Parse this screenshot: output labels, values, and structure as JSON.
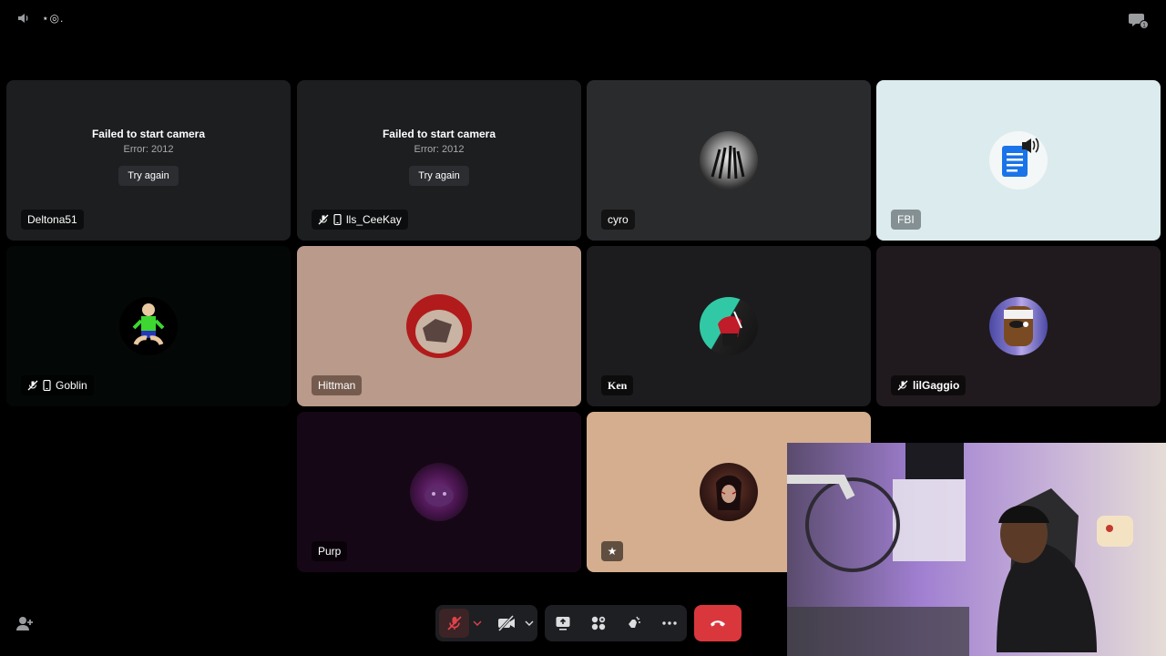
{
  "topbar": {
    "channel_status": "⋆◎."
  },
  "tiles": [
    {
      "name": "Deltona51",
      "camera_failed": true,
      "fail_title": "Failed to start camera",
      "fail_error": "Error: 2012",
      "retry_label": "Try again"
    },
    {
      "name": "lls_CeeKay",
      "camera_failed": true,
      "fail_title": "Failed to start camera",
      "fail_error": "Error: 2012",
      "retry_label": "Try again",
      "muted": true,
      "mobile": true
    },
    {
      "name": "cyro"
    },
    {
      "name": "FBI"
    },
    {
      "name": "Goblin",
      "muted": true,
      "mobile": true
    },
    {
      "name": "Hittman"
    },
    {
      "name": "Ken"
    },
    {
      "name": "lilGaggio",
      "muted": true
    },
    {
      "name": "Purp"
    },
    {
      "name": "★"
    }
  ],
  "controls": {
    "mic": "mic-muted",
    "camera": "camera-off",
    "share": "screen-share",
    "activities": "activities",
    "soundboard": "soundboard",
    "more": "more",
    "disconnect": "disconnect"
  },
  "colors": {
    "background": "#000000",
    "tile_dark": "#1c1e20",
    "fbi_tile": "#dcebed",
    "hittman_tile": "#b99a8b",
    "star_tile": "#d4ae8e",
    "disconnect_red": "#da373c"
  }
}
